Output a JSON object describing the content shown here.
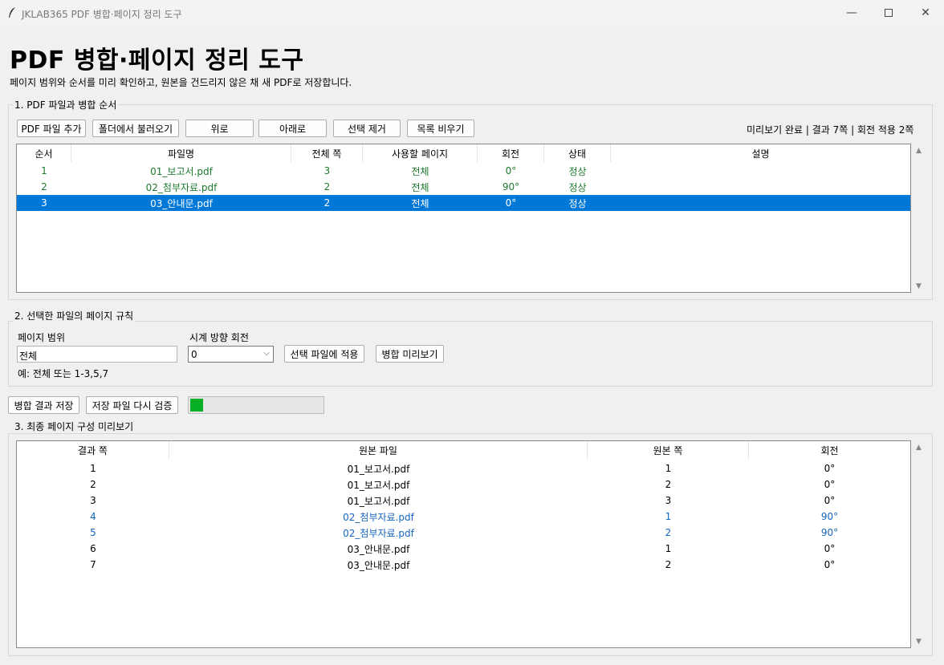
{
  "window": {
    "title": "JKLAB365 PDF 병합·페이지 정리 도구",
    "min_icon": "minimize-icon",
    "max_icon": "maximize-icon",
    "close_icon": "close-icon"
  },
  "header": {
    "title": "PDF 병합·페이지 정리 도구",
    "subtitle": "페이지 범위와 순서를 미리 확인하고, 원본을 건드리지 않은 채 새 PDF로 저장합니다."
  },
  "section1": {
    "label": "1. PDF 파일과 병합 순서",
    "buttons": [
      "PDF 파일 추가",
      "폴더에서 불러오기",
      "위로",
      "아래로",
      "선택 제거",
      "목록 비우기"
    ],
    "status": "미리보기 완료 | 결과 7쪽 | 회전 적용 2쪽",
    "columns": [
      "순서",
      "파일명",
      "전체 쪽",
      "사용할 페이지",
      "회전",
      "상태",
      "설명"
    ],
    "rows": [
      {
        "order": "1",
        "name": "01_보고서.pdf",
        "total": "3",
        "pages": "전체",
        "rotate": "0°",
        "state": "정상",
        "note": ""
      },
      {
        "order": "2",
        "name": "02_첨부자료.pdf",
        "total": "2",
        "pages": "전체",
        "rotate": "90°",
        "state": "정상",
        "note": ""
      },
      {
        "order": "3",
        "name": "03_안내문.pdf",
        "total": "2",
        "pages": "전체",
        "rotate": "0°",
        "state": "정상",
        "note": ""
      }
    ]
  },
  "section2": {
    "label": "2. 선택한 파일의 페이지 규칙",
    "range_label": "페이지 범위",
    "range_value": "전체",
    "range_hint": "예: 전체 또는 1-3,5,7",
    "rotate_label": "시계 방향 회전",
    "rotate_value": "0",
    "apply_button": "선택 파일에 적용",
    "preview_button": "병합 미리보기"
  },
  "actions": {
    "save_button": "병합 결과 저장",
    "verify_button": "저장 파일 다시 검증",
    "progress": 0.1
  },
  "section3": {
    "label": "3. 최종 페이지 구성 미리보기",
    "columns": [
      "결과 쪽",
      "원본 파일",
      "원본 쪽",
      "회전"
    ],
    "rows": [
      {
        "result": "1",
        "file": "01_보고서.pdf",
        "src": "1",
        "rotate": "0°"
      },
      {
        "result": "2",
        "file": "01_보고서.pdf",
        "src": "2",
        "rotate": "0°"
      },
      {
        "result": "3",
        "file": "01_보고서.pdf",
        "src": "3",
        "rotate": "0°"
      },
      {
        "result": "4",
        "file": "02_첨부자료.pdf",
        "src": "1",
        "rotate": "90°"
      },
      {
        "result": "5",
        "file": "02_첨부자료.pdf",
        "src": "2",
        "rotate": "90°"
      },
      {
        "result": "6",
        "file": "03_안내문.pdf",
        "src": "1",
        "rotate": "0°"
      },
      {
        "result": "7",
        "file": "03_안내문.pdf",
        "src": "2",
        "rotate": "0°"
      }
    ]
  }
}
